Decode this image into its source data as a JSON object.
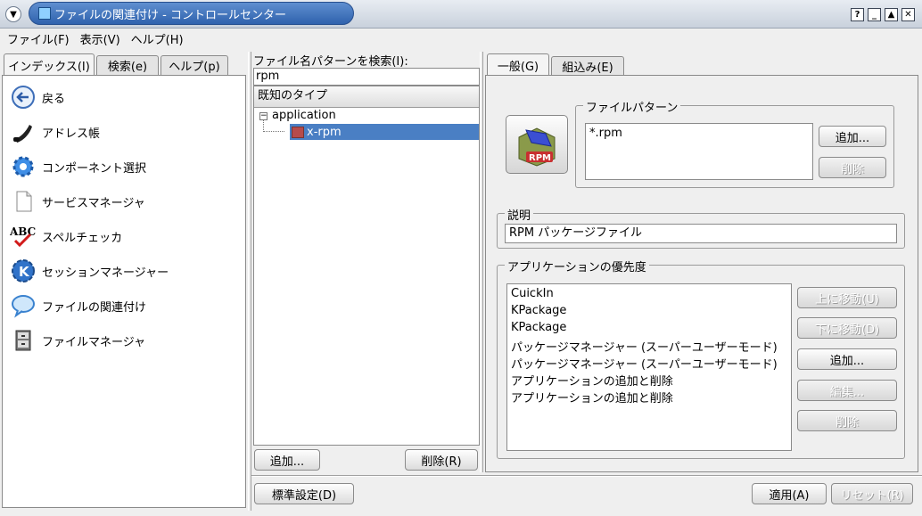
{
  "window": {
    "title": "ファイルの関連付け - コントロールセンター",
    "buttons": {
      "help": "?",
      "minimize": "_",
      "maximize": "▲",
      "close": "✕"
    }
  },
  "menubar": [
    "ファイル(F)",
    "表示(V)",
    "ヘルプ(H)"
  ],
  "left_tabs": [
    "インデックス(I)",
    "検索(e)",
    "ヘルプ(p)"
  ],
  "nav_items": [
    {
      "label": "戻る",
      "icon": "back-arrow-icon"
    },
    {
      "label": "アドレス帳",
      "icon": "phone-icon"
    },
    {
      "label": "コンポーネント選択",
      "icon": "gear-icon"
    },
    {
      "label": "サービスマネージャ",
      "icon": "document-icon"
    },
    {
      "label": "スペルチェッカ",
      "icon": "spellcheck-icon"
    },
    {
      "label": "セッションマネージャー",
      "icon": "kde-session-icon"
    },
    {
      "label": "ファイルの関連付け",
      "icon": "chat-bubble-icon"
    },
    {
      "label": "ファイルマネージャ",
      "icon": "file-cabinet-icon"
    }
  ],
  "search": {
    "label": "ファイル名パターンを検索(I):",
    "value": "rpm"
  },
  "tree": {
    "header": "既知のタイプ",
    "root": "application",
    "child": "x-rpm"
  },
  "middle_buttons": {
    "add": "追加...",
    "remove": "削除(R)"
  },
  "right_tabs": [
    "一般(G)",
    "組込み(E)"
  ],
  "file_pattern": {
    "label": "ファイルパターン",
    "icon_text": "RPM",
    "items": [
      "*.rpm"
    ],
    "add": "追加...",
    "remove": "削除"
  },
  "description": {
    "label": "説明",
    "value": "RPM パッケージファイル"
  },
  "app_priority": {
    "label": "アプリケーションの優先度",
    "items": [
      "CuickIn",
      "KPackage",
      "KPackage",
      "パッケージマネージャー (スーパーユーザーモード)",
      "パッケージマネージャー (スーパーユーザーモード)",
      "アプリケーションの追加と削除",
      "アプリケーションの追加と削除"
    ],
    "buttons": {
      "up": "上に移動(U)",
      "down": "下に移動(D)",
      "add": "追加...",
      "edit": "編集...",
      "remove": "削除"
    }
  },
  "bottom": {
    "defaults": "標準設定(D)",
    "apply": "適用(A)",
    "reset": "リセット(R)"
  },
  "colors": {
    "selection": "#4a7fc4",
    "title": "#3a6cb5"
  }
}
